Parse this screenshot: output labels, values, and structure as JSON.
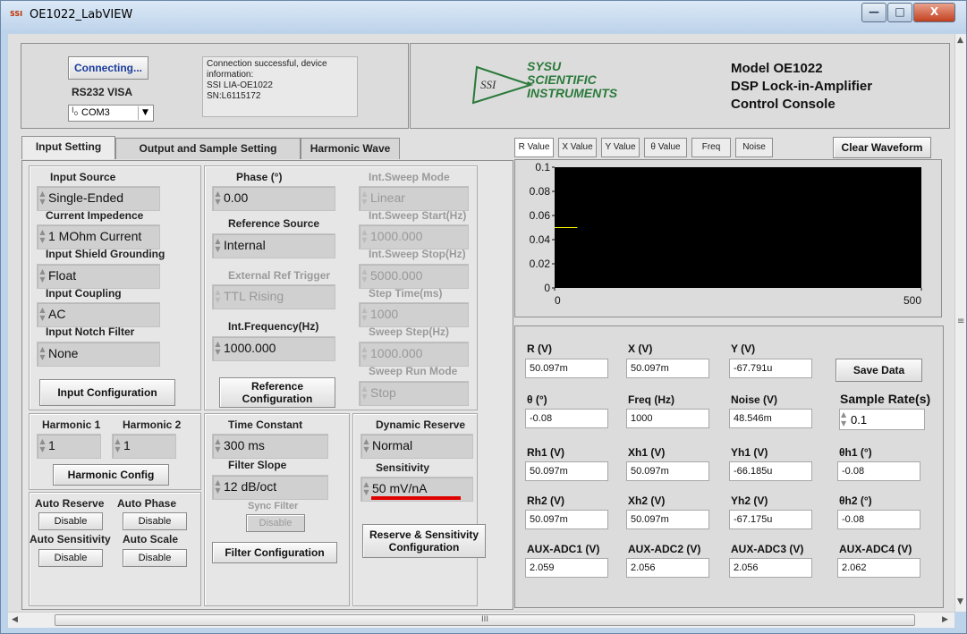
{
  "window": {
    "title": "OE1022_LabVIEW",
    "icon_text": "SSI",
    "min_glyph": "—",
    "max_glyph": "□",
    "close_glyph": "X"
  },
  "connection": {
    "connect_label": "Connecting...",
    "interface_label": "RS232 VISA",
    "com_port": "COM3",
    "info_text": [
      "Connection successful, device",
      "information:",
      "SSI LIA-OE1022",
      "SN:L6115172"
    ]
  },
  "header": {
    "logo_text": "SSI",
    "company_lines": [
      "SYSU",
      "SCIENTIFIC",
      "INSTRUMENTS"
    ],
    "model_lines": [
      "Model OE1022",
      "DSP Lock-in-Amplifier",
      "Control Console"
    ]
  },
  "tabs": [
    "Input Setting",
    "Output and Sample Setting",
    "Harmonic Wave"
  ],
  "input": {
    "source_label": "Input Source",
    "source": "Single-Ended",
    "impedance_label": "Current Impedence",
    "impedance": "1 MOhm Current",
    "shield_label": "Input Shield Grounding",
    "shield": "Float",
    "coupling_label": "Input Coupling",
    "coupling": "AC",
    "notch_label": "Input Notch Filter",
    "notch": "None",
    "config_label": "Input Configuration"
  },
  "reference": {
    "phase_label": "Phase (°)",
    "phase": "0.00",
    "source_label": "Reference Source",
    "source": "Internal",
    "ext_trigger_label": "External Ref Trigger",
    "ext_trigger": "TTL Rising",
    "freq_label": "Int.Frequency(Hz)",
    "freq": "1000.000",
    "config_label_1": "Reference",
    "config_label_2": "Configuration"
  },
  "sweep": {
    "mode_label": "Int.Sweep Mode",
    "mode": "Linear",
    "start_label": "Int.Sweep Start(Hz)",
    "start": "1000.000",
    "stop_label": "Int.Sweep Stop(Hz)",
    "stop": "5000.000",
    "step_time_label": "Step Time(ms)",
    "step_time": "1000",
    "step_label": "Sweep Step(Hz)",
    "step": "1000.000",
    "run_label": "Sweep Run Mode",
    "run": "Stop"
  },
  "harmonic": {
    "h1_label": "Harmonic 1",
    "h1": "1",
    "h2_label": "Harmonic 2",
    "h2": "1",
    "config_label": "Harmonic  Config"
  },
  "auto": {
    "reserve_label": "Auto Reserve",
    "phase_label": "Auto Phase",
    "sensitivity_label": "Auto Sensitivity",
    "scale_label": "Auto Scale",
    "disable": "Disable"
  },
  "filter": {
    "tc_label": "Time Constant",
    "tc": "300 ms",
    "slope_label": "Filter Slope",
    "slope": "12 dB/oct",
    "sync_label": "Sync Filter",
    "sync": "Disable",
    "config_label": "Filter Configuration"
  },
  "reserve": {
    "dr_label": "Dynamic Reserve",
    "dr": "Normal",
    "sens_label": "Sensitivity",
    "sens": "50 mV/nA",
    "config_label_1": "Reserve & Sensitivity",
    "config_label_2": "Configuration"
  },
  "wave_tabs": [
    "R Value",
    "X Value",
    "Y Value",
    "θ Value",
    "Freq",
    "Noise"
  ],
  "clear_label": "Clear Waveform",
  "chart_data": {
    "type": "line",
    "series": [
      {
        "x": [
          0,
          31
        ],
        "y": [
          0.05,
          0.05
        ],
        "color": "#ffff00"
      }
    ],
    "xlim": [
      0,
      500
    ],
    "ylim": [
      0,
      0.1
    ],
    "x_ticks": [
      "0",
      "500"
    ],
    "y_ticks": [
      "0.1",
      "0.08",
      "0.06",
      "0.04",
      "0.02",
      "0"
    ],
    "background": "#000000"
  },
  "measurements": {
    "r_label": "R (V)",
    "r": "50.097m",
    "x_label": "X (V)",
    "x": "50.097m",
    "y_label": "Y (V)",
    "y": "-67.791u",
    "save_label": "Save Data",
    "theta_label": "θ (°)",
    "theta": "-0.08",
    "freq_label": "Freq (Hz)",
    "freq": "1000",
    "noise_label": "Noise (V)",
    "noise": "48.546m",
    "rate_label": "Sample Rate(s)",
    "rate": "0.1",
    "rh1_label": "Rh1 (V)",
    "rh1": "50.097m",
    "xh1_label": "Xh1 (V)",
    "xh1": "50.097m",
    "yh1_label": "Yh1 (V)",
    "yh1": "-66.185u",
    "th1_label": "θh1 (°)",
    "th1": "-0.08",
    "rh2_label": "Rh2 (V)",
    "rh2": "50.097m",
    "xh2_label": "Xh2 (V)",
    "xh2": "50.097m",
    "yh2_label": "Yh2 (V)",
    "yh2": "-67.175u",
    "th2_label": "θh2 (°)",
    "th2": "-0.08",
    "aux1_label": "AUX-ADC1 (V)",
    "aux1": "2.059",
    "aux2_label": "AUX-ADC2 (V)",
    "aux2": "2.056",
    "aux3_label": "AUX-ADC3 (V)",
    "aux3": "2.056",
    "aux4_label": "AUX-ADC4 (V)",
    "aux4": "2.062"
  },
  "hscroll_glyph": "III"
}
